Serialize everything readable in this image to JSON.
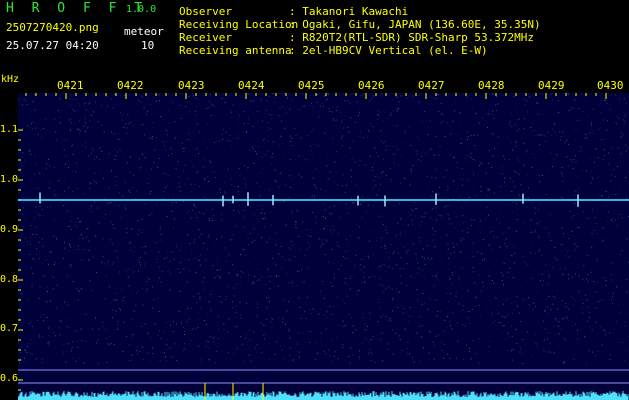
{
  "header": {
    "app_title": "H R O F F T",
    "version": "1.0.0",
    "filename": "2507270420.png",
    "meteor_label": "meteor",
    "datetime": "25.07.27 04:20",
    "meteor_count": "10"
  },
  "info": {
    "keys": "Observer\nReceiving Location\nReceiver\nReceiving antenna",
    "values": ": Takanori Kawachi\n: Ogaki, Gifu, JAPAN (136.60E, 35.35N)\n: R820T2(RTL-SDR) SDR-Sharp 53.372MHz\n: 2el-HB9CV Vertical (el. E-W)"
  },
  "axis": {
    "unit": "kHz",
    "y_labels": [
      "1.1",
      "1.0",
      "0.9",
      "0.8",
      "0.7",
      "0.6"
    ],
    "x_labels": [
      "0421",
      "0422",
      "0423",
      "0424",
      "0425",
      "0426",
      "0427",
      "0428",
      "0429",
      "0430"
    ]
  },
  "colors": {
    "green": "#2ee82e",
    "yellow": "#ffff00",
    "background": "#00003a",
    "signal": "#38d8ff"
  }
}
